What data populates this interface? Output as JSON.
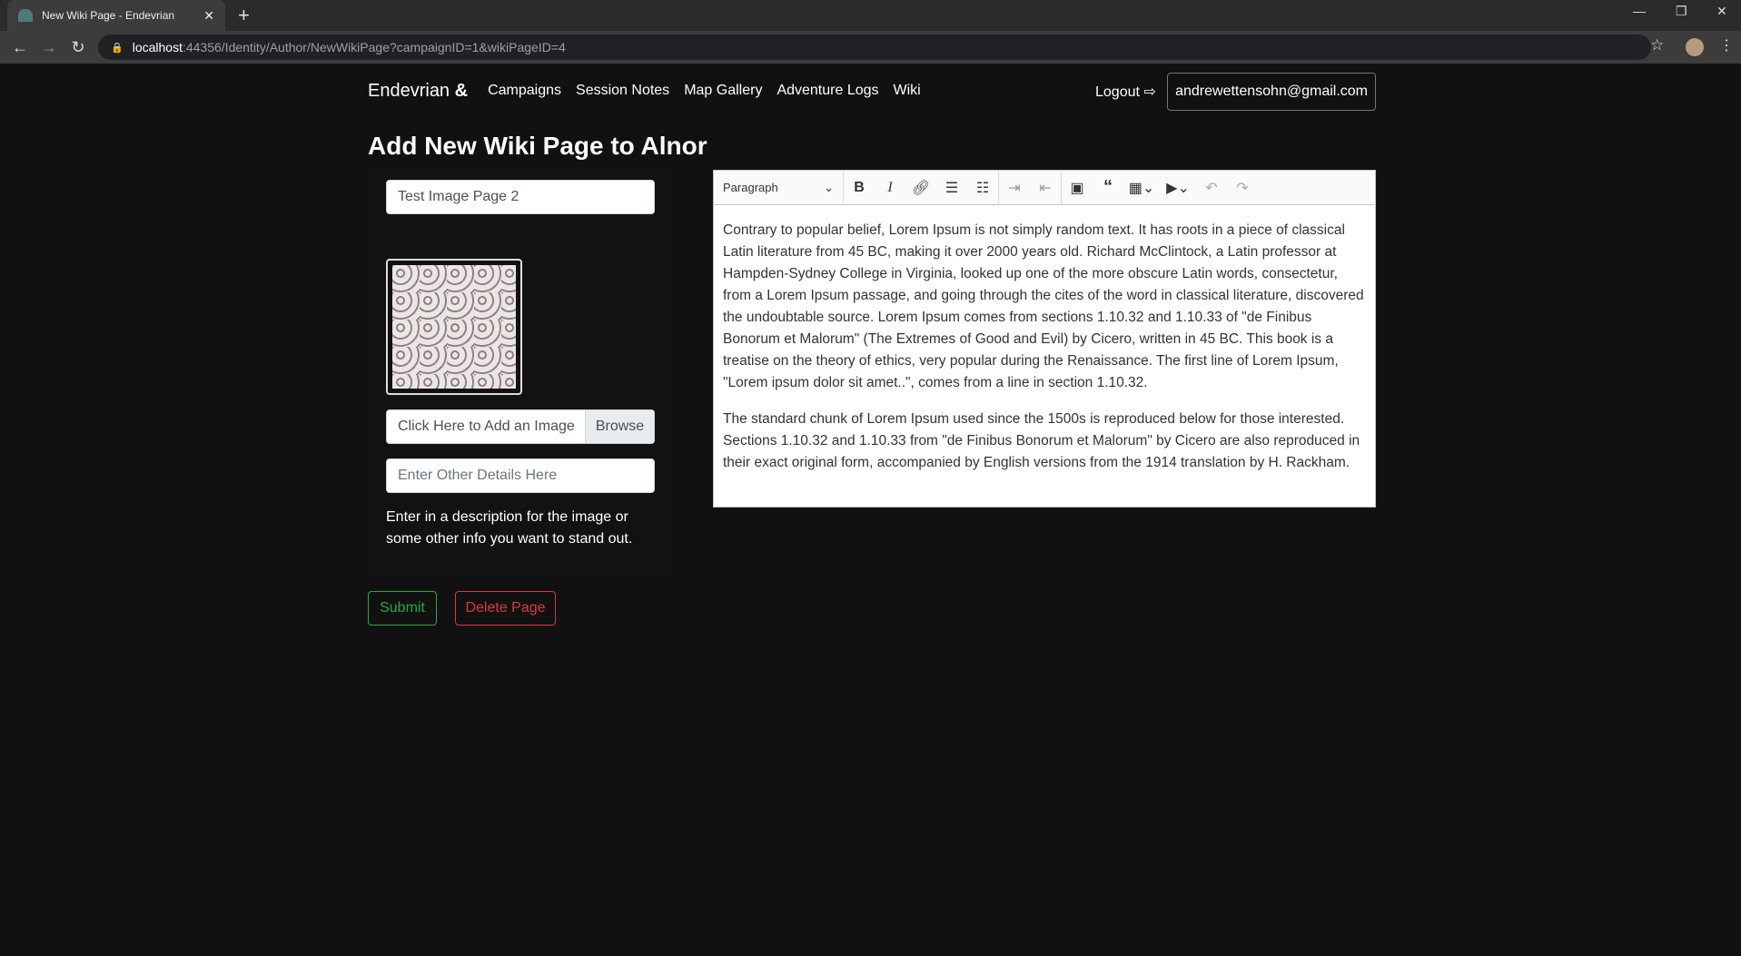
{
  "browser": {
    "tab_title": "New Wiki Page - Endevrian",
    "url_host": "localhost",
    "url_rest": ":44356/Identity/Author/NewWikiPage?campaignID=1&wikiPageID=4"
  },
  "nav": {
    "brand": "Endevrian",
    "brand_symbol": "&",
    "links": [
      "Campaigns",
      "Session Notes",
      "Map Gallery",
      "Adventure Logs",
      "Wiki"
    ],
    "logout": "Logout",
    "email": "andrewettensohn@gmail.com"
  },
  "page": {
    "title": "Add New Wiki Page to Alnor"
  },
  "form": {
    "title_value": "Test Image Page 2",
    "file_label": "Click Here to Add an Image",
    "browse": "Browse",
    "details_placeholder": "Enter Other Details Here",
    "description": "Enter in a description for the image or some other info you want to stand out.",
    "submit": "Submit",
    "delete": "Delete Page"
  },
  "editor": {
    "block_format": "Paragraph",
    "paragraphs": [
      "Contrary to popular belief, Lorem Ipsum is not simply random text. It has roots in a piece of classical Latin literature from 45 BC, making it over 2000 years old. Richard McClintock, a Latin professor at Hampden-Sydney College in Virginia, looked up one of the more obscure Latin words, consectetur, from a Lorem Ipsum passage, and going through the cites of the word in classical literature, discovered the undoubtable source. Lorem Ipsum comes from sections 1.10.32 and 1.10.33 of \"de Finibus Bonorum et Malorum\" (The Extremes of Good and Evil) by Cicero, written in 45 BC. This book is a treatise on the theory of ethics, very popular during the Renaissance. The first line of Lorem Ipsum, \"Lorem ipsum dolor sit amet..\", comes from a line in section 1.10.32.",
      "The standard chunk of Lorem Ipsum used since the 1500s is reproduced below for those interested. Sections 1.10.32 and 1.10.33 from \"de Finibus Bonorum et Malorum\" by Cicero are also reproduced in their exact original form, accompanied by English versions from the 1914 translation by H. Rackham."
    ]
  },
  "colors": {
    "success": "#28a745",
    "danger": "#dc3545"
  }
}
